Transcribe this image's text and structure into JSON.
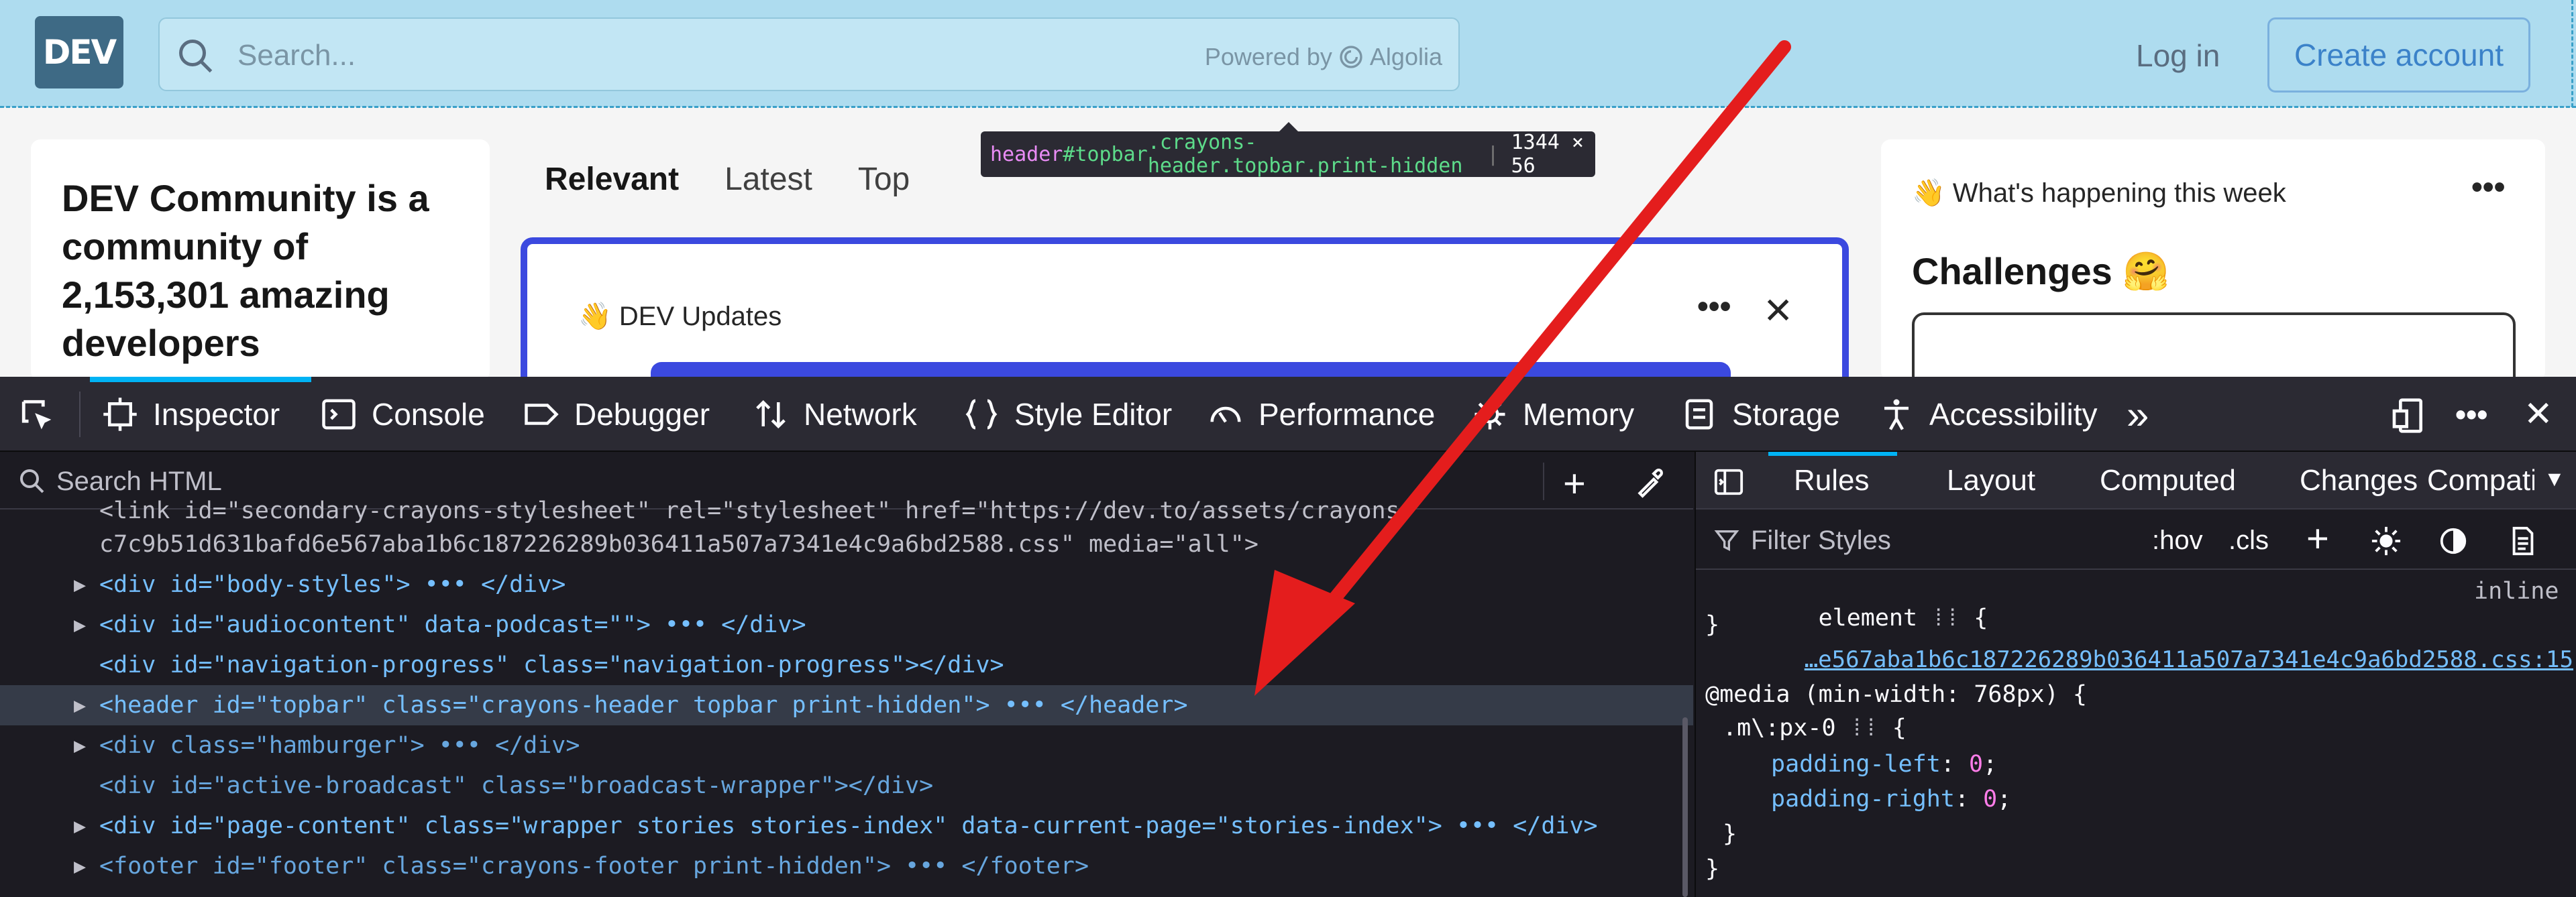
{
  "page": {
    "logo_text": "DEV",
    "search_placeholder": "Search...",
    "search_powered": "Powered by",
    "search_powered_brand": "Algolia",
    "login_label": "Log in",
    "create_account_label": "Create account",
    "tooltip": {
      "tag": "header",
      "id": "#topbar",
      "classes": ".crayons-header.topbar.print-hidden",
      "size": "1344 × 56"
    },
    "left_card_title": "DEV Community is a community of 2,153,301 amazing developers",
    "feed_tabs": [
      "Relevant",
      "Latest",
      "Top"
    ],
    "updates_title": "👋 DEV Updates",
    "updates_more": "•••",
    "updates_close": "✕",
    "happening_title": "👋 What's happening this week",
    "happening_more": "•••",
    "challenges_title": "Challenges 🤗"
  },
  "devtools": {
    "tabs": [
      "Inspector",
      "Console",
      "Debugger",
      "Network",
      "Style Editor",
      "Performance",
      "Memory",
      "Storage",
      "Accessibility"
    ],
    "overflow": "»",
    "more": "•••",
    "close": "✕",
    "search_html_placeholder": "Search HTML",
    "markup_lines": [
      "<link id=\"secondary-crayons-stylesheet\" rel=\"stylesheet\" href=\"https://dev.to/assets/crayons-",
      "c7c9b51d631bafd6e567aba1b6c187226289b036411a507a7341e4c9a6bd2588.css\" media=\"all\">",
      "<div id=\"body-styles\"> ••• </div>",
      "<div id=\"audiocontent\" data-podcast=\"\"> ••• </div>",
      "<div id=\"navigation-progress\" class=\"navigation-progress\"></div>",
      "<header id=\"topbar\" class=\"crayons-header topbar print-hidden\"> ••• </header>",
      "<div class=\"hamburger\"> ••• </div>",
      "<div id=\"active-broadcast\" class=\"broadcast-wrapper\"></div>",
      "<div id=\"page-content\" class=\"wrapper stories stories-index\" data-current-page=\"stories-index\"> ••• </div>",
      "<footer id=\"footer\" class=\"crayons-footer print-hidden\"> ••• </footer>"
    ],
    "sidebar_tabs": [
      "Rules",
      "Layout",
      "Computed",
      "Changes",
      "Compati"
    ],
    "filter_placeholder": "Filter Styles",
    "hov_label": ":hov",
    "cls_label": ".cls",
    "rules": {
      "element_selector": "element",
      "inline_label": "inline",
      "source_link": "…e567aba1b6c187226289b036411a507a7341e4c9a6bd2588.css:15",
      "media": "@media (min-width: 768px) {",
      "selector": ".m\\:px-0",
      "decl_1_prop": "padding-left",
      "decl_1_val": "0",
      "decl_2_prop": "padding-right",
      "decl_2_val": "0"
    }
  },
  "colors": {
    "topbar_highlight": "#aedcef",
    "annotation_arrow": "#e41d1d",
    "devtools_bg": "#1c1b22",
    "accent": "#00b3f4"
  }
}
